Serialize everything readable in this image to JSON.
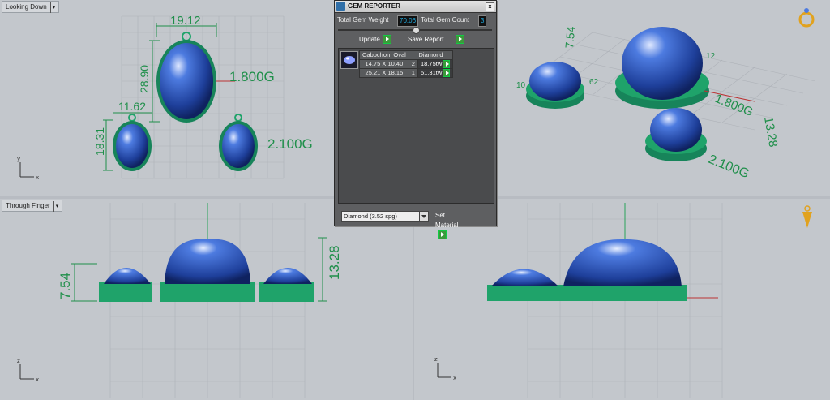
{
  "viewports": {
    "top_left": {
      "label": "Looking Down",
      "dims": {
        "width_large": "19.12",
        "height_large": "28.90",
        "width_small": "11.62",
        "height_small": "18.31",
        "weight_large": "1.800G",
        "weight_small": "2.100G"
      },
      "axis": {
        "x": "x",
        "y": "y"
      }
    },
    "top_right": {
      "dims": {
        "height_left": "7.54",
        "height_right": "13.28",
        "weight_large": "1.800G",
        "weight_small": "2.100G",
        "d1": "12",
        "d2": "10",
        "d3": "62"
      }
    },
    "bottom_left": {
      "label": "Through Finger",
      "dims": {
        "height_left": "7.54",
        "height_right": "13.28"
      },
      "axis": {
        "x": "x",
        "z": "z"
      }
    },
    "bottom_right": {
      "axis": {
        "x": "x",
        "z": "z"
      }
    }
  },
  "gem_reporter": {
    "title": "GEM REPORTER",
    "total_weight_label": "Total Gem Weight",
    "total_weight_value": "70.06",
    "total_count_label": "Total Gem Count",
    "total_count_value": "3",
    "update_label": "Update",
    "save_report_label": "Save Report",
    "columns": [
      "Cabochon_Oval",
      "Diamond"
    ],
    "rows": [
      {
        "size": "14.75 X 10.40",
        "count": "2",
        "weight": "18.75tw"
      },
      {
        "size": "25.21 X 18.15",
        "count": "1",
        "weight": "51.31tw"
      }
    ],
    "material_selected": "Diamond    (3.52 spg)",
    "set_material_label": "Set Material"
  },
  "colors": {
    "gem_blue": "#2f5fc8",
    "prong_green": "#1fa36a",
    "dimension_green": "#1f8f4a"
  }
}
